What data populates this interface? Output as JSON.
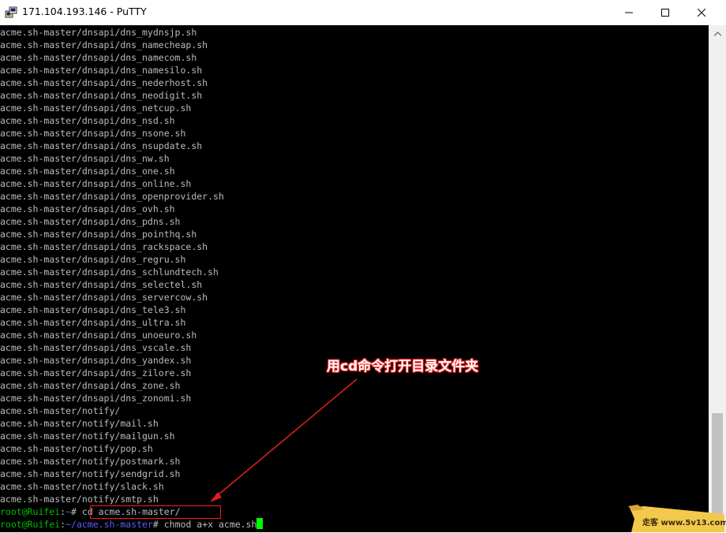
{
  "window": {
    "title": "171.104.193.146 - PuTTY",
    "icons": {
      "app": "putty-icon",
      "minimize": "minimize-icon",
      "maximize": "maximize-icon",
      "close": "close-icon"
    }
  },
  "terminal": {
    "lines": [
      "acme.sh-master/dnsapi/dns_mydnsjp.sh",
      "acme.sh-master/dnsapi/dns_namecheap.sh",
      "acme.sh-master/dnsapi/dns_namecom.sh",
      "acme.sh-master/dnsapi/dns_namesilo.sh",
      "acme.sh-master/dnsapi/dns_nederhost.sh",
      "acme.sh-master/dnsapi/dns_neodigit.sh",
      "acme.sh-master/dnsapi/dns_netcup.sh",
      "acme.sh-master/dnsapi/dns_nsd.sh",
      "acme.sh-master/dnsapi/dns_nsone.sh",
      "acme.sh-master/dnsapi/dns_nsupdate.sh",
      "acme.sh-master/dnsapi/dns_nw.sh",
      "acme.sh-master/dnsapi/dns_one.sh",
      "acme.sh-master/dnsapi/dns_online.sh",
      "acme.sh-master/dnsapi/dns_openprovider.sh",
      "acme.sh-master/dnsapi/dns_ovh.sh",
      "acme.sh-master/dnsapi/dns_pdns.sh",
      "acme.sh-master/dnsapi/dns_pointhq.sh",
      "acme.sh-master/dnsapi/dns_rackspace.sh",
      "acme.sh-master/dnsapi/dns_regru.sh",
      "acme.sh-master/dnsapi/dns_schlundtech.sh",
      "acme.sh-master/dnsapi/dns_selectel.sh",
      "acme.sh-master/dnsapi/dns_servercow.sh",
      "acme.sh-master/dnsapi/dns_tele3.sh",
      "acme.sh-master/dnsapi/dns_ultra.sh",
      "acme.sh-master/dnsapi/dns_unoeuro.sh",
      "acme.sh-master/dnsapi/dns_vscale.sh",
      "acme.sh-master/dnsapi/dns_yandex.sh",
      "acme.sh-master/dnsapi/dns_zilore.sh",
      "acme.sh-master/dnsapi/dns_zone.sh",
      "acme.sh-master/dnsapi/dns_zonomi.sh",
      "acme.sh-master/notify/",
      "acme.sh-master/notify/mail.sh",
      "acme.sh-master/notify/mailgun.sh",
      "acme.sh-master/notify/pop.sh",
      "acme.sh-master/notify/postmark.sh",
      "acme.sh-master/notify/sendgrid.sh",
      "acme.sh-master/notify/slack.sh",
      "acme.sh-master/notify/smtp.sh"
    ],
    "prompt1": {
      "user_host": "root@Ruifei",
      "sep": ":",
      "path": "~",
      "symbol": "# ",
      "command": "cd acme.sh-master/"
    },
    "prompt2": {
      "user_host": "root@Ruifei",
      "sep": ":",
      "path": "~/acme.sh-master",
      "symbol": "# ",
      "command": "chmod a+x acme.sh"
    },
    "colors": {
      "background": "#000000",
      "text": "#bbbbbb",
      "user_host": "#00bb00",
      "path": "#5c5cff",
      "cursor": "#00ff00"
    }
  },
  "annotation": {
    "text": "用cd命令打开目录文件夹",
    "color": "#e02020"
  },
  "watermark": {
    "text": "走客 www.5v13.com"
  }
}
